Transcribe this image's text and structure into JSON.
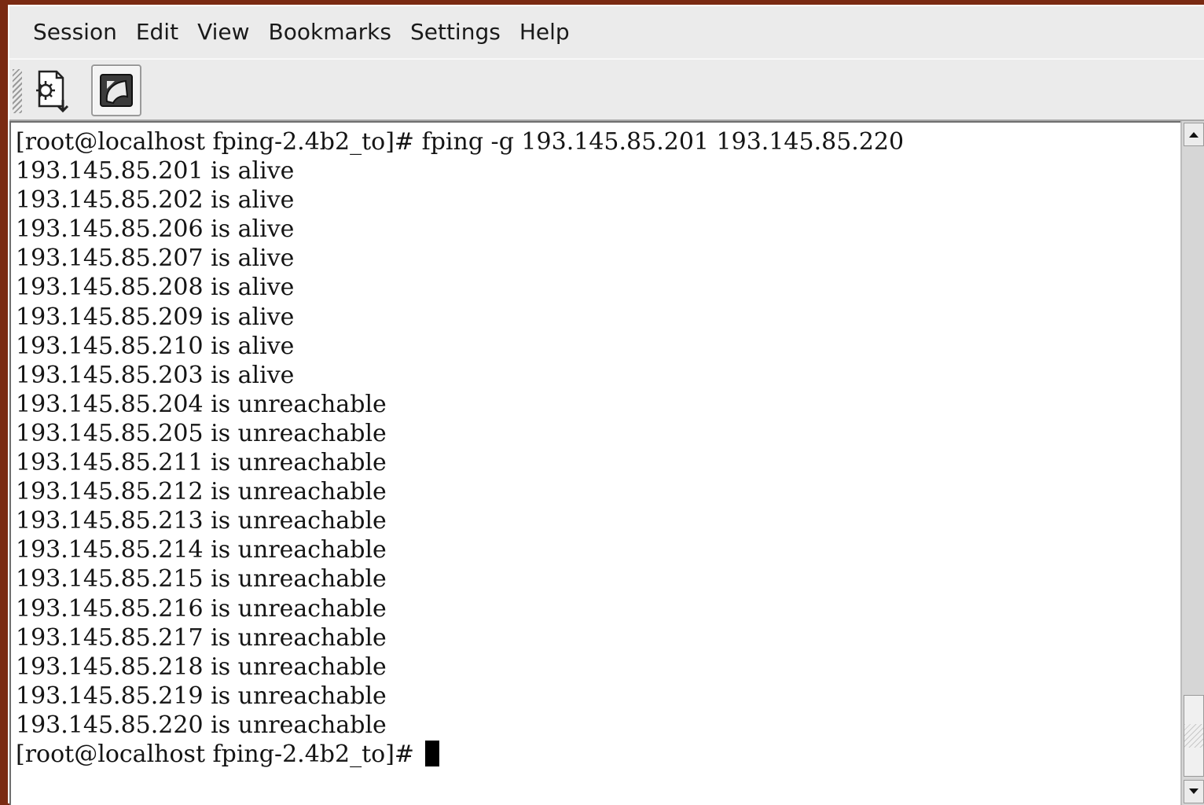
{
  "menu": [
    "Session",
    "Edit",
    "View",
    "Bookmarks",
    "Settings",
    "Help"
  ],
  "toolbar": {
    "new_session_icon": "new-session-icon",
    "fullscreen_icon": "fullscreen-icon"
  },
  "terminal": {
    "lines": [
      "[root@localhost fping-2.4b2_to]# fping -g 193.145.85.201 193.145.85.220",
      "193.145.85.201 is alive",
      "193.145.85.202 is alive",
      "193.145.85.206 is alive",
      "193.145.85.207 is alive",
      "193.145.85.208 is alive",
      "193.145.85.209 is alive",
      "193.145.85.210 is alive",
      "193.145.85.203 is alive",
      "193.145.85.204 is unreachable",
      "193.145.85.205 is unreachable",
      "193.145.85.211 is unreachable",
      "193.145.85.212 is unreachable",
      "193.145.85.213 is unreachable",
      "193.145.85.214 is unreachable",
      "193.145.85.215 is unreachable",
      "193.145.85.216 is unreachable",
      "193.145.85.217 is unreachable",
      "193.145.85.218 is unreachable",
      "193.145.85.219 is unreachable",
      "193.145.85.220 is unreachable"
    ],
    "prompt": "[root@localhost fping-2.4b2_to]# "
  },
  "colors": {
    "background": "#7a2a12",
    "chrome": "#ebebeb",
    "terminal_bg": "#ffffff",
    "terminal_fg": "#141414"
  }
}
